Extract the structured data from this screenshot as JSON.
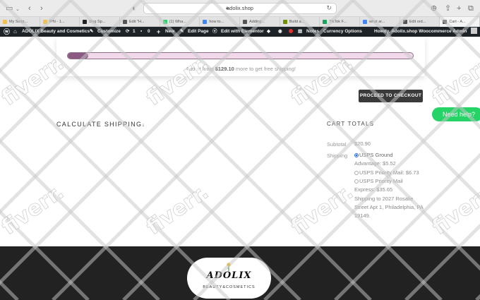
{
  "browser": {
    "url": "adolix.shop"
  },
  "tabs": [
    {
      "label": "My Scrip...",
      "color": "#f2c14e"
    },
    {
      "label": "IPN - 1...",
      "color": "#f2c14e"
    },
    {
      "label": "Dog Sp...",
      "color": "#222222"
    },
    {
      "label": "Edit \"H...",
      "color": "#555555"
    },
    {
      "label": "(1) Wha...",
      "color": "#25d366"
    },
    {
      "label": "how to...",
      "color": "#4285f4"
    },
    {
      "label": "Adding...",
      "color": "#555555"
    },
    {
      "label": "Build a...",
      "color": "#6f8f00"
    },
    {
      "label": "TikTok F...",
      "color": "#1aa35b"
    },
    {
      "label": "what ar...",
      "color": "#4285f4"
    },
    {
      "label": "Edit ord...",
      "color": "#555555"
    },
    {
      "label": "Cart - A...",
      "color": "#555555"
    }
  ],
  "admin_bar": {
    "site": "ADOLIX Beauty and Cosmetics",
    "customize": "Customize",
    "updates_count": "1",
    "comments_count": "0",
    "new": "New",
    "edit_page": "Edit Page",
    "elementor": "Edit with Elementor",
    "notes": "Notes",
    "currency": "Currency Options",
    "howdy": "Howdy, Adolix.shop Woocommerce Admin"
  },
  "free_shipping": {
    "prefix": "Add at least",
    "amount": "$129.10",
    "suffix": "more to get free shipping!",
    "progress": 0.04
  },
  "checkout_button": "PROCEED TO CHECKOUT",
  "calculate_shipping": "CALCULATE SHIPPING",
  "calculate_arrow": "↓",
  "cart_totals": {
    "title": "CART TOTALS",
    "subtotal_label": "Subtotal",
    "subtotal_value": "$20.90",
    "shipping_label": "Shipping",
    "option1": "USPS Ground",
    "option1b": "Advantage: $5.52",
    "option2": "USPS Priority Mail: $6.73",
    "option3": "USPS Priority Mail",
    "option3b": "Express: $35.65",
    "address_1": "Shipping to 2027 Rosalie",
    "address_2": "Street Apt 1, Philadelphia, PA",
    "address_3": "19149."
  },
  "help_button": "Need help?",
  "footer": {
    "brand": "ADOLIX",
    "tagline": "BEAUTY&COSMETICS"
  },
  "watermark": "fiverr."
}
